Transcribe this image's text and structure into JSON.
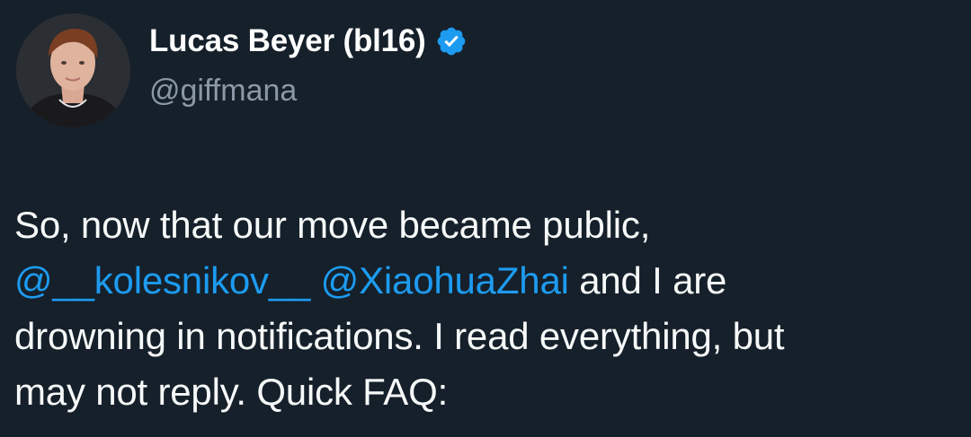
{
  "author": {
    "display_name": "Lucas Beyer (bl16)",
    "handle": "@giffmana",
    "verified": true,
    "verified_icon": "verified-badge-icon",
    "accent": "#1d9bf0"
  },
  "tweet": {
    "line1": "So, now that our move became public,",
    "mention1": "@__kolesnikov__",
    "mention2": "@XiaohuaZhai",
    "line2_rest": "and I are",
    "line3": "drowning in notifications. I read everything, but",
    "line4": "may not reply. Quick FAQ:"
  },
  "colors": {
    "background": "#15202b",
    "text": "#f7f9f9",
    "secondary_text": "#8b98a5",
    "link": "#1d9bf0"
  }
}
